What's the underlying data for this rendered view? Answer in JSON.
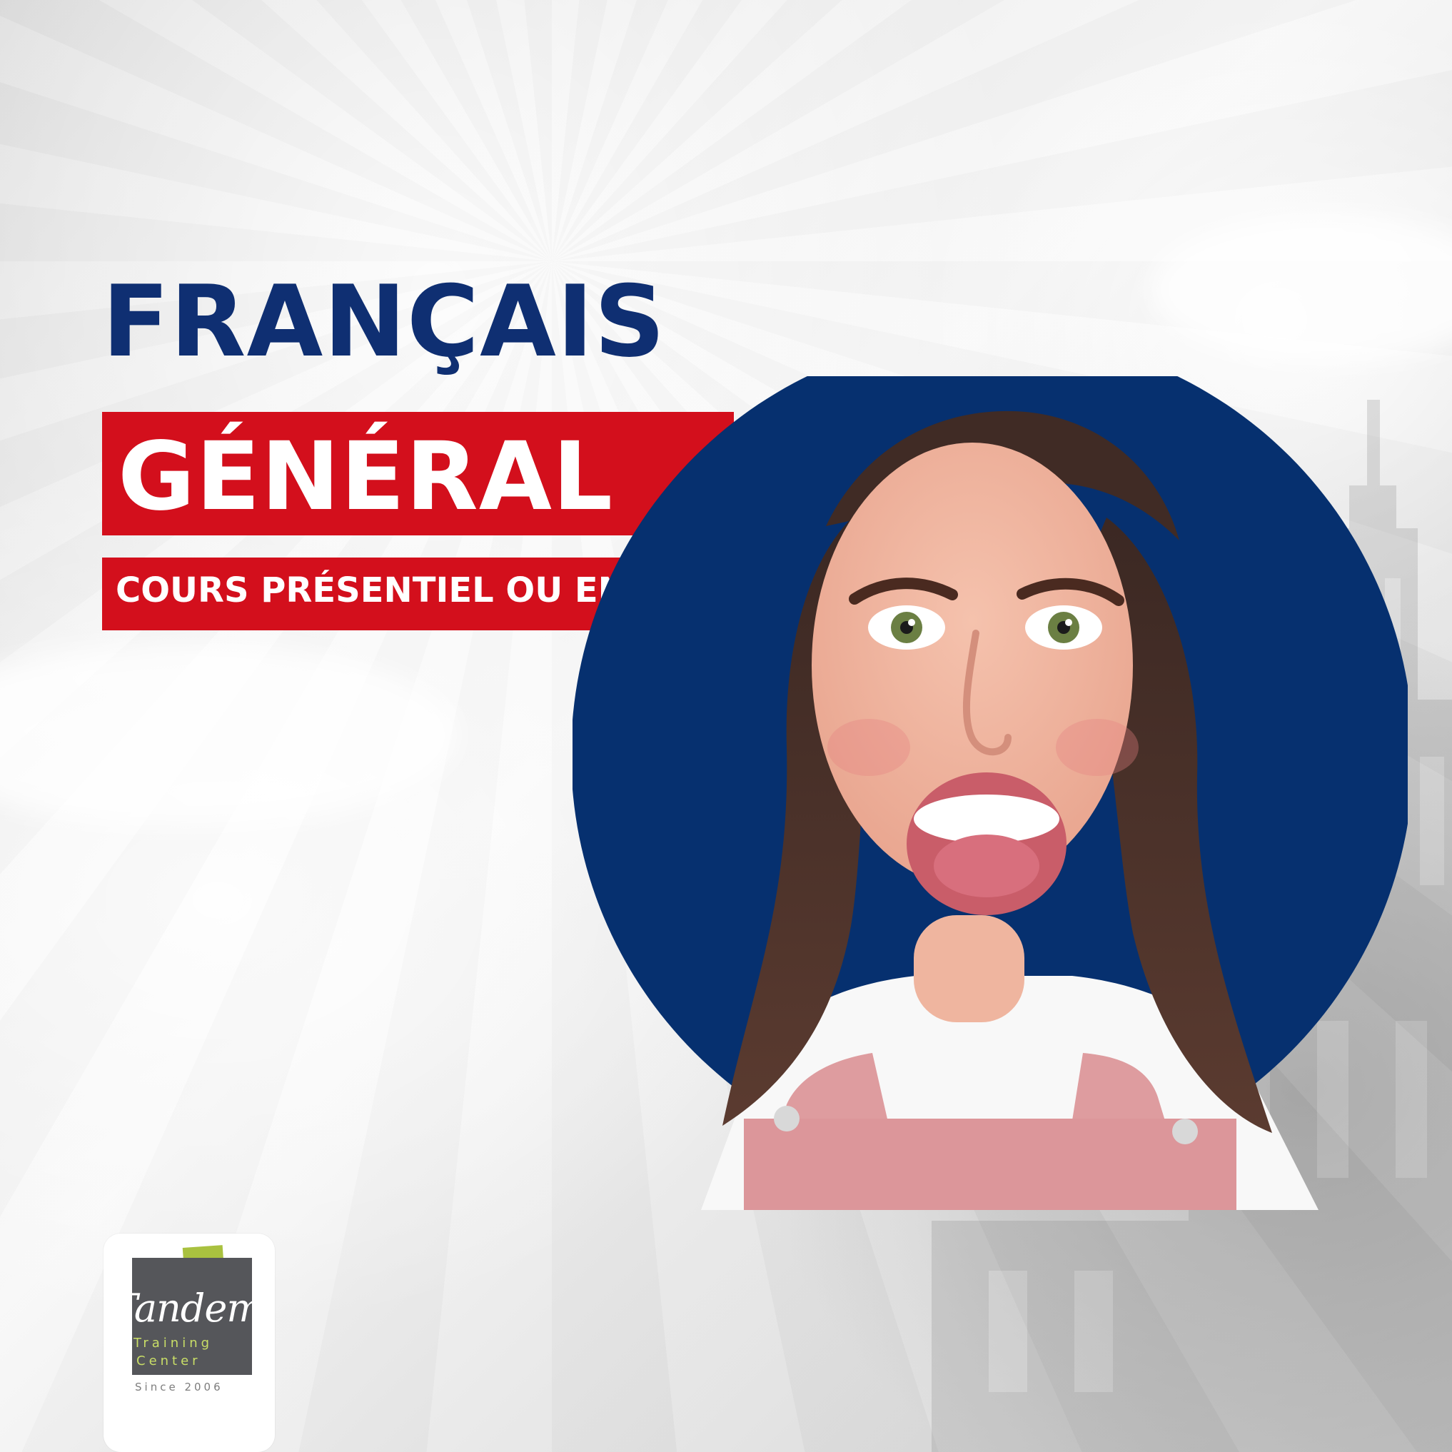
{
  "poster": {
    "title_main": "FRANÇAIS",
    "title_sub": "GÉNÉRAL",
    "subtitle": "COURS PRÉSENTIEL OU EN LIGNE"
  },
  "logo": {
    "brand": "Tandem",
    "training": "Training",
    "center": "Center",
    "since": "Since 2006"
  },
  "colors": {
    "primary_blue": "#0f2f72",
    "accent_red": "#d30f1c",
    "logo_green": "#a9c13f",
    "logo_dark": "#55565a",
    "background": "#ececec"
  },
  "image": {
    "subject": "smiling-woman-photo"
  }
}
